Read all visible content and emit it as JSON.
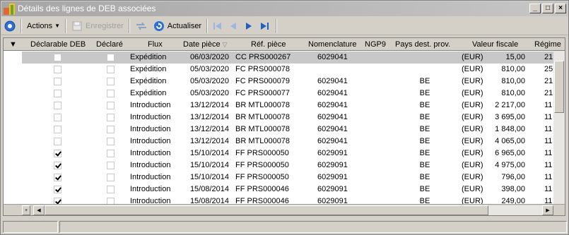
{
  "window": {
    "title": "Détails des lignes de DEB associées",
    "controls": {
      "minimize": "_",
      "maximize": "□",
      "close": "×"
    }
  },
  "toolbar": {
    "actions_label": "Actions",
    "save_label": "Enregistrer",
    "refresh_label": "Actualiser"
  },
  "grid": {
    "columns": [
      "Déclarable DEB",
      "Déclaré",
      "Flux",
      "Date pièce",
      "Réf. pièce",
      "Nomenclature",
      "NGP9",
      "Pays dest. prov.",
      "Valeur fiscale",
      "Régime"
    ],
    "rows": [
      {
        "declarable": false,
        "declare": false,
        "flux": "Expédition",
        "date": "06/03/2020",
        "ref": "CC PRS000267",
        "nomenclature": "6029041",
        "ngp9": "",
        "pays": "",
        "devise": "(EUR)",
        "valeur": "15,00",
        "regime": "21",
        "selected": true
      },
      {
        "declarable": false,
        "declare": false,
        "flux": "Expédition",
        "date": "05/03/2020",
        "ref": "FC PRS000078",
        "nomenclature": "",
        "ngp9": "",
        "pays": "",
        "devise": "(EUR)",
        "valeur": "810,00",
        "regime": "25",
        "selected": false
      },
      {
        "declarable": false,
        "declare": false,
        "flux": "Expédition",
        "date": "05/03/2020",
        "ref": "FC PRS000079",
        "nomenclature": "6029041",
        "ngp9": "",
        "pays": "BE",
        "devise": "(EUR)",
        "valeur": "810,00",
        "regime": "21",
        "selected": false
      },
      {
        "declarable": false,
        "declare": false,
        "flux": "Expédition",
        "date": "05/03/2020",
        "ref": "FC PRS000077",
        "nomenclature": "6029041",
        "ngp9": "",
        "pays": "BE",
        "devise": "(EUR)",
        "valeur": "810,00",
        "regime": "21",
        "selected": false
      },
      {
        "declarable": false,
        "declare": false,
        "flux": "Introduction",
        "date": "13/12/2014",
        "ref": "BR MTL000078",
        "nomenclature": "6029041",
        "ngp9": "",
        "pays": "BE",
        "devise": "(EUR)",
        "valeur": "2 217,00",
        "regime": "11",
        "selected": false
      },
      {
        "declarable": false,
        "declare": false,
        "flux": "Introduction",
        "date": "13/12/2014",
        "ref": "BR MTL000078",
        "nomenclature": "6029041",
        "ngp9": "",
        "pays": "BE",
        "devise": "(EUR)",
        "valeur": "3 695,00",
        "regime": "11",
        "selected": false
      },
      {
        "declarable": false,
        "declare": false,
        "flux": "Introduction",
        "date": "13/12/2014",
        "ref": "BR MTL000078",
        "nomenclature": "6029041",
        "ngp9": "",
        "pays": "BE",
        "devise": "(EUR)",
        "valeur": "1 848,00",
        "regime": "11",
        "selected": false
      },
      {
        "declarable": false,
        "declare": false,
        "flux": "Introduction",
        "date": "13/12/2014",
        "ref": "BR MTL000078",
        "nomenclature": "6029041",
        "ngp9": "",
        "pays": "BE",
        "devise": "(EUR)",
        "valeur": "4 065,00",
        "regime": "11",
        "selected": false
      },
      {
        "declarable": true,
        "declare": false,
        "flux": "Introduction",
        "date": "15/10/2014",
        "ref": "FF PRS000050",
        "nomenclature": "6029091",
        "ngp9": "",
        "pays": "BE",
        "devise": "(EUR)",
        "valeur": "6 965,00",
        "regime": "11",
        "selected": false
      },
      {
        "declarable": true,
        "declare": false,
        "flux": "Introduction",
        "date": "15/10/2014",
        "ref": "FF PRS000050",
        "nomenclature": "6029091",
        "ngp9": "",
        "pays": "BE",
        "devise": "(EUR)",
        "valeur": "4 975,00",
        "regime": "11",
        "selected": false
      },
      {
        "declarable": true,
        "declare": false,
        "flux": "Introduction",
        "date": "15/10/2014",
        "ref": "FF PRS000050",
        "nomenclature": "6029091",
        "ngp9": "",
        "pays": "BE",
        "devise": "(EUR)",
        "valeur": "796,00",
        "regime": "11",
        "selected": false
      },
      {
        "declarable": true,
        "declare": false,
        "flux": "Introduction",
        "date": "15/08/2014",
        "ref": "FF PRS000046",
        "nomenclature": "6029091",
        "ngp9": "",
        "pays": "BE",
        "devise": "(EUR)",
        "valeur": "398,00",
        "regime": "11",
        "selected": false
      },
      {
        "declarable": true,
        "declare": false,
        "flux": "Introduction",
        "date": "15/08/2014",
        "ref": "FF PRS000046",
        "nomenclature": "6029091",
        "ngp9": "",
        "pays": "BE",
        "devise": "(EUR)",
        "valeur": "249,00",
        "regime": "11",
        "selected": false
      }
    ],
    "footer_button": "+"
  },
  "colors": {
    "accent": "#1f5fbf",
    "titlebar": "#b0b0b0",
    "selection": "#c8c8c8"
  }
}
